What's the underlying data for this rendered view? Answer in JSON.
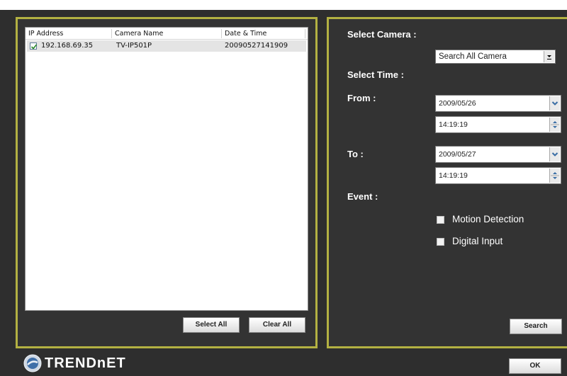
{
  "list": {
    "columns": [
      "IP Address",
      "Camera Name",
      "Date & Time"
    ],
    "rows": [
      {
        "checked": true,
        "ip": "192.168.69.35",
        "camera": "TV-IP501P",
        "datetime": "20090527141909"
      }
    ]
  },
  "buttons": {
    "select_all": "Select All",
    "clear_all": "Clear All",
    "search": "Search",
    "ok": "OK"
  },
  "filters": {
    "select_camera_label": "Select Camera :",
    "camera_value": "Search All Camera",
    "select_time_label": "Select Time :",
    "from_label": "From :",
    "from_date": "2009/05/26",
    "from_time": "14:19:19",
    "to_label": "To :",
    "to_date": "2009/05/27",
    "to_time": "14:19:19",
    "event_label": "Event :",
    "events": [
      {
        "label": "Motion Detection",
        "checked": false
      },
      {
        "label": "Digital Input",
        "checked": false
      }
    ]
  },
  "brand": {
    "logo_text": "TRENDnET"
  },
  "colors": {
    "panel_border": "#b3b142",
    "background": "#2e2e2e"
  }
}
